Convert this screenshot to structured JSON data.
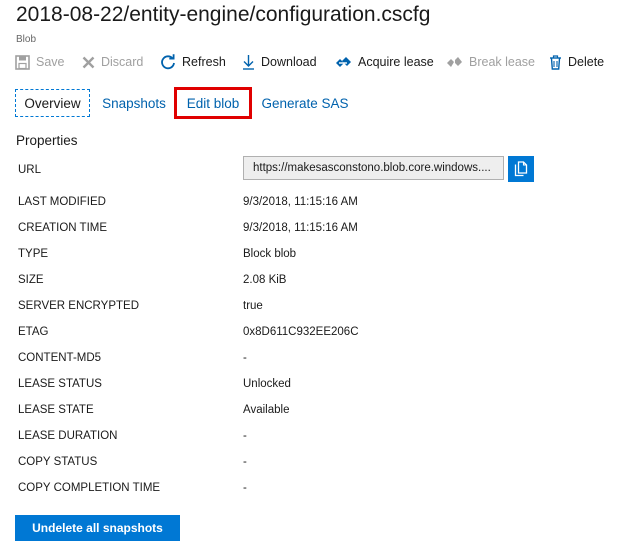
{
  "header": {
    "title": "2018-08-22/entity-engine/configuration.cscfg",
    "subtitle": "Blob"
  },
  "toolbar": {
    "save": "Save",
    "discard": "Discard",
    "refresh": "Refresh",
    "download": "Download",
    "acquire_lease": "Acquire lease",
    "break_lease": "Break lease",
    "delete": "Delete"
  },
  "tabs": {
    "overview": "Overview",
    "snapshots": "Snapshots",
    "edit_blob": "Edit blob",
    "generate_sas": "Generate SAS"
  },
  "properties": {
    "section_title": "Properties",
    "url_label": "URL",
    "url_value": "https://makesasconstono.blob.core.windows....",
    "rows": [
      {
        "label": "LAST MODIFIED",
        "value": "9/3/2018, 11:15:16 AM"
      },
      {
        "label": "CREATION TIME",
        "value": "9/3/2018, 11:15:16 AM"
      },
      {
        "label": "TYPE",
        "value": "Block blob"
      },
      {
        "label": "SIZE",
        "value": "2.08 KiB"
      },
      {
        "label": "SERVER ENCRYPTED",
        "value": "true"
      },
      {
        "label": "ETAG",
        "value": "0x8D611C932EE206C"
      },
      {
        "label": "CONTENT-MD5",
        "value": "-"
      },
      {
        "label": "LEASE STATUS",
        "value": "Unlocked"
      },
      {
        "label": "LEASE STATE",
        "value": "Available"
      },
      {
        "label": "LEASE DURATION",
        "value": "-"
      },
      {
        "label": "COPY STATUS",
        "value": "-"
      },
      {
        "label": "COPY COMPLETION TIME",
        "value": "-"
      }
    ]
  },
  "actions": {
    "undelete": "Undelete all snapshots"
  },
  "colors": {
    "accent": "#0078d4",
    "link": "#0062ad",
    "highlight": "#e00000",
    "disabled": "#a0a0a0"
  },
  "icons": {
    "save": "save-icon",
    "discard": "close-icon",
    "refresh": "refresh-icon",
    "download": "download-icon",
    "acquire_lease": "acquire-lease-icon",
    "break_lease": "break-lease-icon",
    "delete": "trash-icon",
    "copy": "copy-icon"
  }
}
